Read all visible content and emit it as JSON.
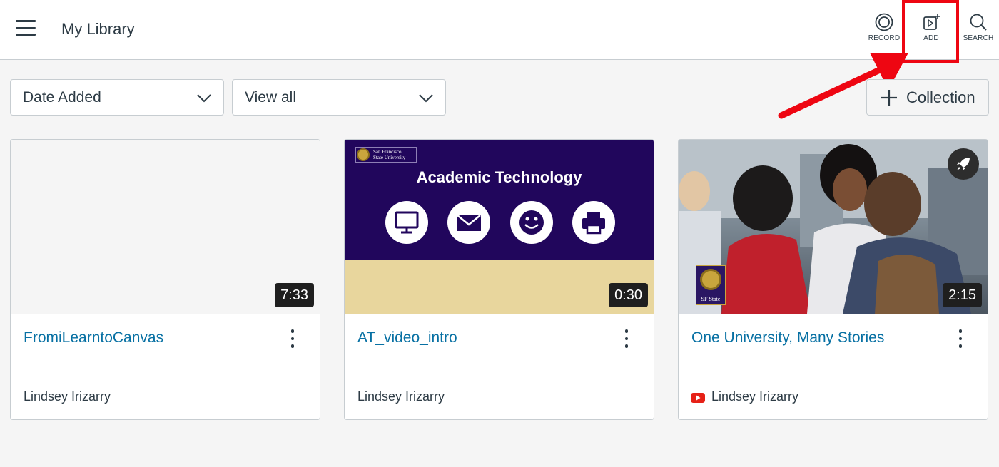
{
  "header": {
    "title": "My Library",
    "tools": {
      "record": "RECORD",
      "add": "ADD",
      "search": "SEARCH"
    }
  },
  "toolbar": {
    "sort": {
      "value": "Date Added"
    },
    "view": {
      "value": "View all"
    },
    "collection_label": "Collection"
  },
  "cards": [
    {
      "title": "FromiLearntoCanvas",
      "duration": "7:33",
      "owner": "Lindsey Irizarry"
    },
    {
      "title": "AT_video_intro",
      "duration": "0:30",
      "owner": "Lindsey Irizarry",
      "thumbnail": {
        "logo_text_line1": "San Francisco",
        "logo_text_line2": "State University",
        "heading": "Academic Technology",
        "icons": [
          "monitor-icon",
          "envelope-icon",
          "smiley-icon",
          "printer-icon"
        ]
      }
    },
    {
      "title": "One University, Many Stories",
      "duration": "2:15",
      "owner": "Lindsey Irizarry",
      "source_icon": "youtube-icon",
      "thumbnail": {
        "badge_text": "SF State"
      }
    }
  ],
  "colors": {
    "link": "#0770a3",
    "text": "#2d3b45",
    "annotation": "#ee0612",
    "at_purple": "#21065c",
    "at_gold": "#e8d69d"
  }
}
